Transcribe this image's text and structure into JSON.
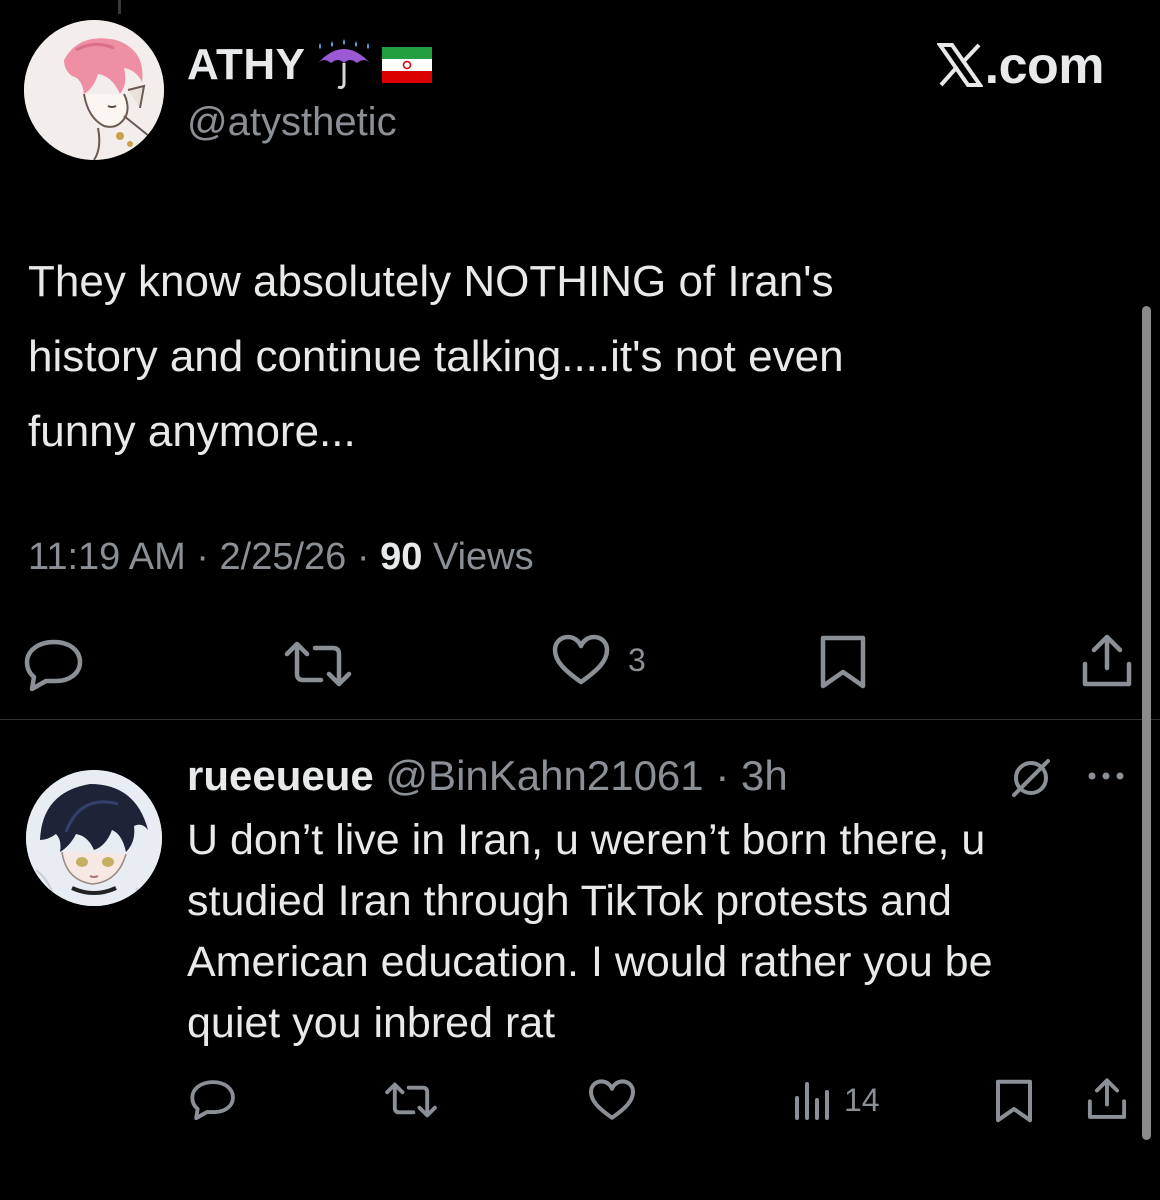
{
  "header": {
    "display_name": "ATHY",
    "handle": "@atysthetic",
    "site_label": ".com",
    "name_emoji_icons": [
      "umbrella-with-rain-icon",
      "iran-flag-icon"
    ]
  },
  "tweet": {
    "lines": [
      "They know absolutely NOTHING of Iran's",
      "history and continue talking....it's not even",
      "funny anymore..."
    ],
    "time": "11:19 AM",
    "date": "2/25/26",
    "views_count": "90",
    "views_label": "Views",
    "separator": "·",
    "actions": {
      "reply": {
        "icon": "reply-icon"
      },
      "repost": {
        "icon": "repost-icon"
      },
      "like": {
        "icon": "heart-icon",
        "count": "3"
      },
      "bookmark": {
        "icon": "bookmark-icon"
      },
      "share": {
        "icon": "share-icon"
      }
    }
  },
  "reply": {
    "name": "rueeueue",
    "handle": "@BinKahn21061",
    "separator": "·",
    "time": "3h",
    "lines": [
      "U don’t live in Iran, u weren’t born there, u",
      "studied Iran through TikTok protests and",
      "American education. I would rather you be",
      "quiet you inbred rat"
    ],
    "actions": {
      "reply": {
        "icon": "reply-icon"
      },
      "repost": {
        "icon": "repost-icon"
      },
      "like": {
        "icon": "heart-icon"
      },
      "views": {
        "icon": "views-icon",
        "count": "14"
      },
      "bookmark": {
        "icon": "bookmark-icon"
      },
      "share": {
        "icon": "share-icon"
      }
    }
  },
  "colors": {
    "background": "#000000",
    "text_primary": "#e7e9ea",
    "text_secondary": "#8b9096",
    "divider": "#2f3336"
  }
}
